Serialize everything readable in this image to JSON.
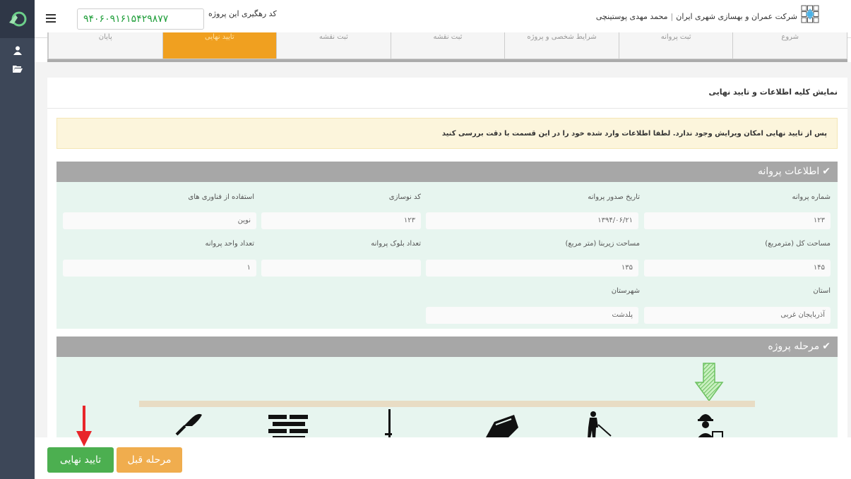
{
  "header": {
    "tracking_code": "۹۴۰۶۰۹۱۶۱۵۴۲۹۸۷۷",
    "tracking_label": "کد رهگیری این پروژه",
    "company": "شرکت عمران و بهسازی شهری ایران",
    "user": "محمد مهدی پوستینچی"
  },
  "tabs": [
    {
      "label": "شروع",
      "active": false
    },
    {
      "label": "ثبت پروانه",
      "active": false
    },
    {
      "label": "شرایط شخصی و پروژه",
      "active": false
    },
    {
      "label": "ثبت نقشه",
      "active": false
    },
    {
      "label": "ثبت نقشه",
      "active": false
    },
    {
      "label": "تایید نهایی",
      "active": true
    },
    {
      "label": "پایان",
      "active": false
    }
  ],
  "panel": {
    "title": "نمایش کلیه اطلاعات و تایید نهایی",
    "warning": "پس از تایید نهایی امکان ویرایش وجود ندارد. لطفا اطلاعات وارد شده خود را در این قسمت با دقت بررسی کنید"
  },
  "license": {
    "title": "اطلاعات پروانه",
    "fields": {
      "license_number": {
        "label": "شماره پروانه",
        "value": "۱۲۳"
      },
      "issue_date": {
        "label": "تاریخ صدور پروانه",
        "value": "۱۳۹۴/۰۶/۲۱"
      },
      "renovation_code": {
        "label": "کد نوسازی",
        "value": "۱۲۳"
      },
      "technology": {
        "label": "استفاده از فناوری های",
        "value": "نوین"
      },
      "total_area": {
        "label": "مساحت کل (مترمربع)",
        "value": "۱۴۵"
      },
      "built_area": {
        "label": "مساحت زیربنا (متر مربع)",
        "value": "۱۳۵"
      },
      "block_count": {
        "label": "تعداد بلوک پروانه",
        "value": ""
      },
      "unit_count": {
        "label": "تعداد واحد پروانه",
        "value": "۱"
      },
      "province": {
        "label": "استان",
        "value": "آذربایجان غربی"
      },
      "city": {
        "label": "شهرستان",
        "value": "پلدشت"
      }
    }
  },
  "stage": {
    "title": "مرحله پروژه",
    "icons": [
      "worker-icon",
      "worker-digging-icon",
      "concrete-mixer-icon",
      "crane-icon",
      "brick-wall-icon",
      "trowel-icon"
    ]
  },
  "actions": {
    "final_label": "تایید نهایی",
    "prev_label": "مرحله قبل"
  },
  "colors": {
    "rail": "#3d4758",
    "active_tab": "#f0a020",
    "final_button": "#4caf50",
    "prev_button": "#f0ad4e",
    "section_bar": "#a7a7a7",
    "section_body": "#e7f5ef",
    "warning_bg": "#fcf5dc",
    "current_stage_arrow": "#8bd17c",
    "annotation_arrow": "#e8262a"
  }
}
